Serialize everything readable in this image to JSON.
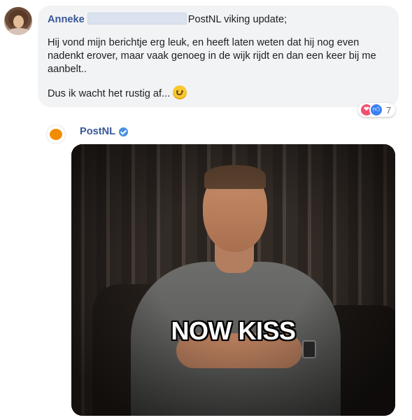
{
  "comment": {
    "author": "Anneke",
    "line1_after_redaction": "PostNL viking update;",
    "paragraph1": "Hij vond mijn berichtje erg leuk, en heeft laten weten dat hij nog even nadenkt erover, maar vaak genoeg in de wijk rijdt en dan een keer bij me aanbelt..",
    "paragraph2": "Dus ik wacht het rustig af...",
    "emoji": "smiling-face-emoji",
    "reactions": {
      "types": [
        "love",
        "like"
      ],
      "count": "7",
      "love_color": "#f0506e",
      "like_color": "#3b7ff5"
    }
  },
  "reply": {
    "author": "PostNL",
    "verified": true,
    "logo_color": "#f28c00",
    "gif": {
      "caption": "NOW KISS"
    }
  },
  "colors": {
    "author_link": "#385898",
    "bubble_bg": "#f2f3f5",
    "verified_badge": "#4a90e2"
  }
}
